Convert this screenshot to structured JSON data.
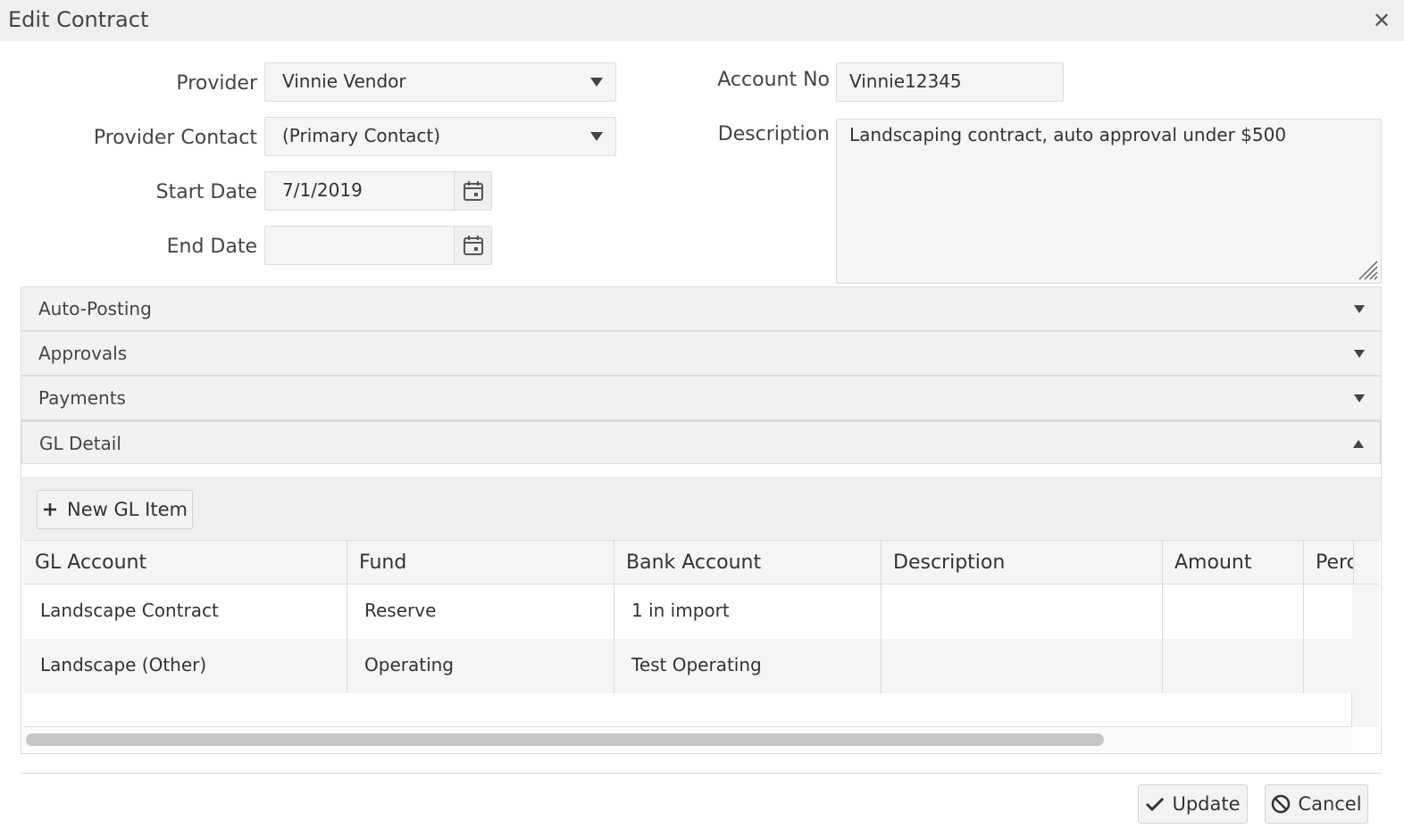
{
  "dialog": {
    "title": "Edit Contract",
    "close_symbol": "✕"
  },
  "form": {
    "provider_label": "Provider",
    "provider_value": "Vinnie Vendor",
    "provider_contact_label": "Provider Contact",
    "provider_contact_value": "(Primary Contact)",
    "start_date_label": "Start Date",
    "start_date_value": "7/1/2019",
    "end_date_label": "End Date",
    "end_date_value": "",
    "account_no_label": "Account No",
    "account_no_value": "Vinnie12345",
    "description_label": "Description",
    "description_value": "Landscaping contract, auto approval under $500"
  },
  "sections": [
    {
      "label": "Auto-Posting",
      "expanded": false
    },
    {
      "label": "Approvals",
      "expanded": false
    },
    {
      "label": "Payments",
      "expanded": false
    },
    {
      "label": "GL Detail",
      "expanded": true
    }
  ],
  "gl_detail": {
    "new_item_label": "New GL Item",
    "columns": [
      "GL Account",
      "Fund",
      "Bank Account",
      "Description",
      "Amount",
      "Perc"
    ],
    "rows": [
      {
        "gl_account": "Landscape Contract",
        "fund": "Reserve",
        "bank_account": "1 in import",
        "description": "",
        "amount": "",
        "percent": ""
      },
      {
        "gl_account": "Landscape (Other)",
        "fund": "Operating",
        "bank_account": "Test Operating",
        "description": "",
        "amount": "",
        "percent": ""
      }
    ]
  },
  "footer": {
    "update_label": "Update",
    "cancel_label": "Cancel"
  },
  "icons": {
    "dropdown": "chevron-down-icon",
    "calendar": "calendar-icon",
    "close": "close-icon",
    "plus": "plus-icon",
    "check": "check-icon",
    "cancel": "ban-icon"
  },
  "colors": {
    "title_bar": "#efefef",
    "panel_header": "#f2f2f2",
    "alt_row": "#f5f5f5",
    "scroll_thumb": "#c6c6c6"
  }
}
